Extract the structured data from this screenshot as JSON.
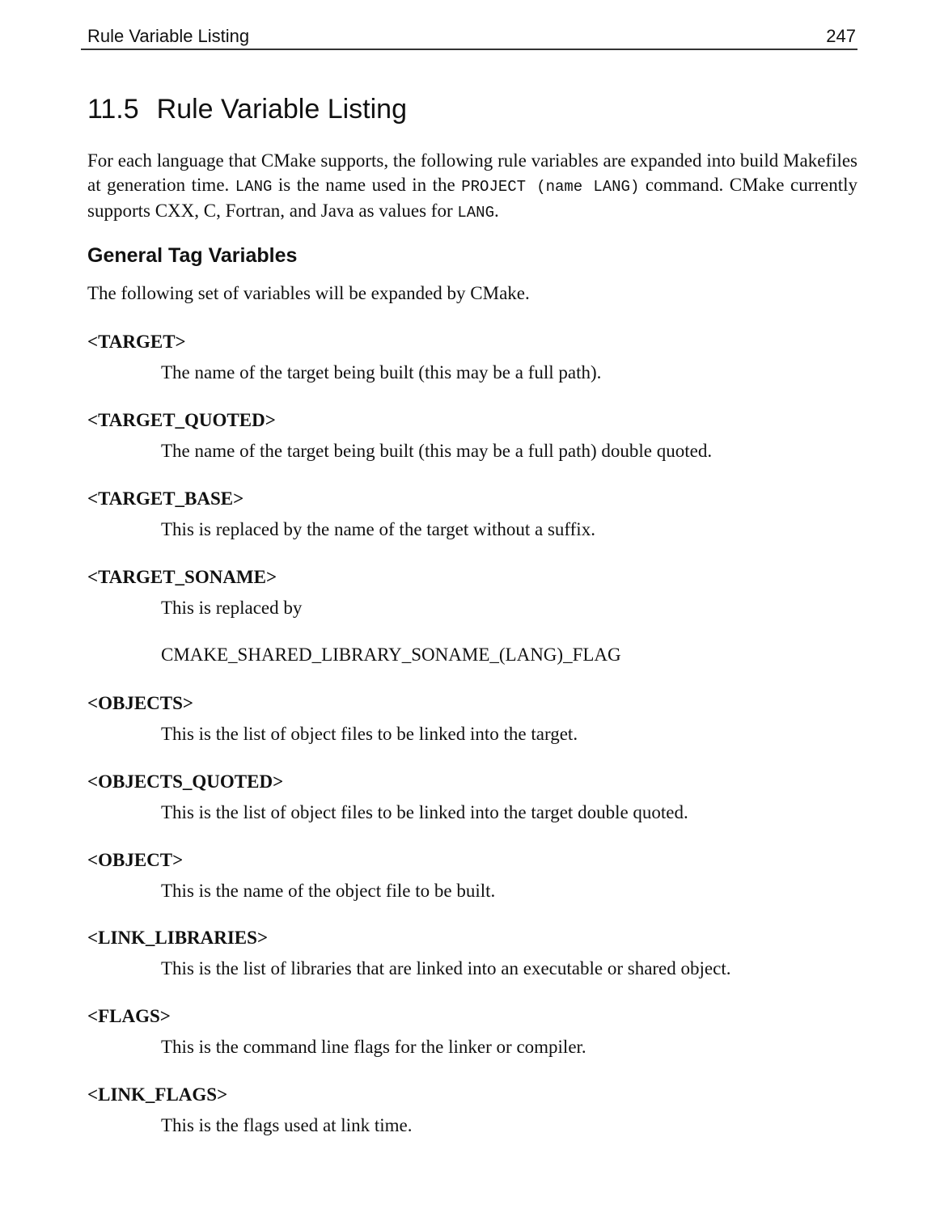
{
  "header": {
    "title": "Rule Variable Listing",
    "page_number": "247"
  },
  "section": {
    "number": "11.5",
    "title": "Rule Variable Listing"
  },
  "intro": {
    "part1": "For each language that CMake supports, the following rule variables are expanded into build Makefiles at generation time. ",
    "code1": "LANG",
    "part2": " is the name used in the ",
    "code2": "PROJECT (name LANG)",
    "part3": " command. CMake currently supports CXX, C, Fortran, and Java as values for ",
    "code3": "LANG",
    "part4": "."
  },
  "subsection": {
    "title": "General Tag Variables",
    "lead": "The following set of variables will be expanded by CMake."
  },
  "variables": [
    {
      "name": "<TARGET>",
      "description": "The name of the target being built (this may be a full path)."
    },
    {
      "name": "<TARGET_QUOTED>",
      "description": "The name of the target being built (this may be a full path) double quoted."
    },
    {
      "name": "<TARGET_BASE>",
      "description": "This is replaced by the name of the target without a suffix."
    },
    {
      "name": "<TARGET_SONAME>",
      "description": "This is replaced by",
      "extra": "CMAKE_SHARED_LIBRARY_SONAME_(LANG)_FLAG"
    },
    {
      "name": "<OBJECTS>",
      "description": "This is the list of object files to be linked into the target."
    },
    {
      "name": "<OBJECTS_QUOTED>",
      "description": "This is the list of object files to be linked into the target double quoted."
    },
    {
      "name": "<OBJECT>",
      "description": "This is the name of the object file to be built."
    },
    {
      "name": "<LINK_LIBRARIES>",
      "description": "This is the list of libraries that are linked into an executable or shared object."
    },
    {
      "name": "<FLAGS>",
      "description": "This is the command line flags for the linker or compiler."
    },
    {
      "name": "<LINK_FLAGS>",
      "description": "This is the flags used at link time."
    }
  ]
}
